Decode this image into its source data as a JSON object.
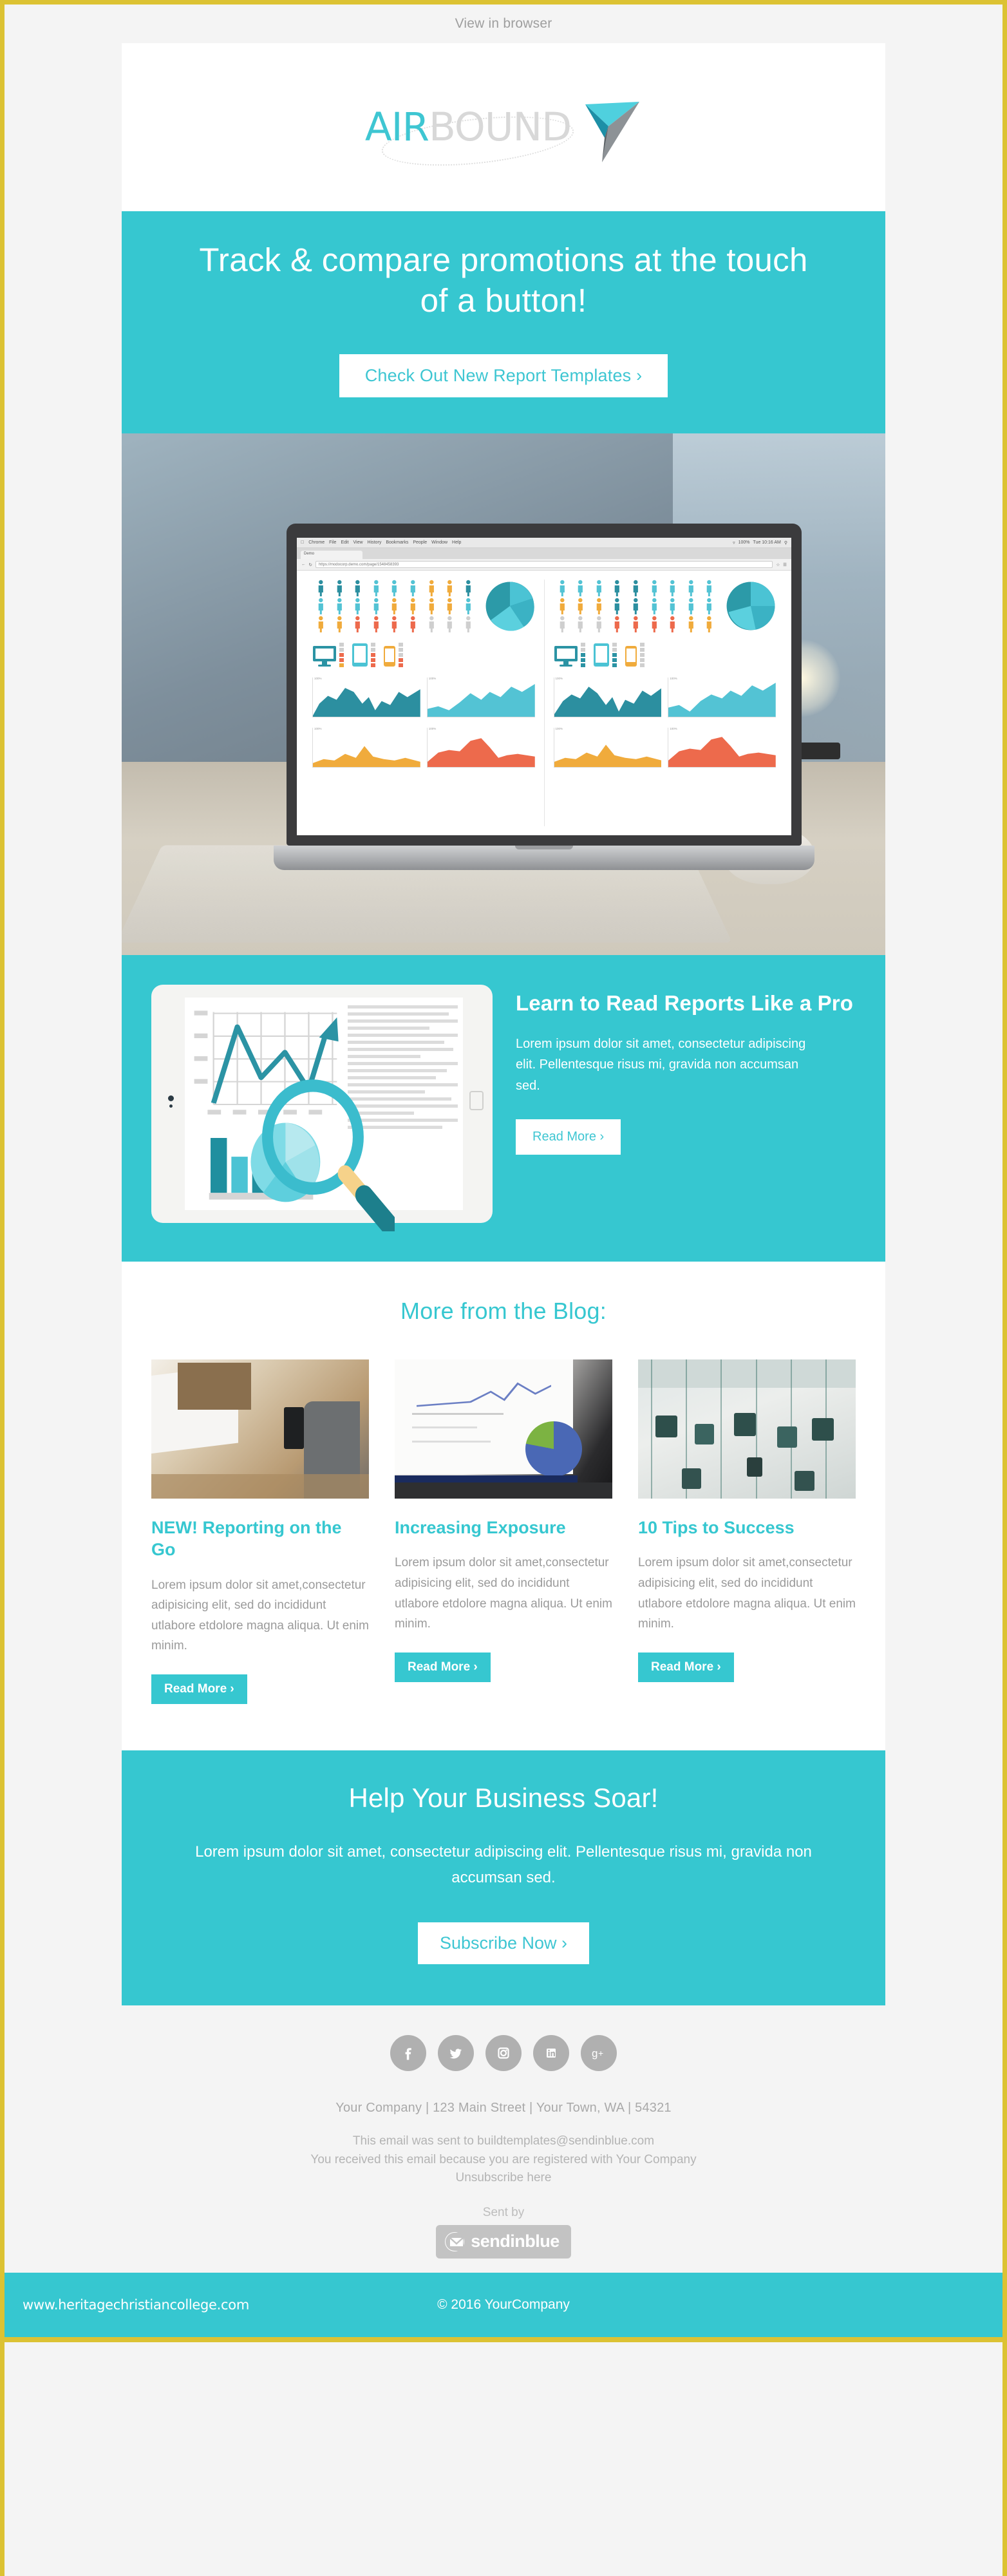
{
  "preheader": {
    "view_in_browser": "View in browser"
  },
  "brand": {
    "logo_air": "AIR",
    "logo_bound": "BOUND",
    "accent_color": "#36c7d0",
    "logo_teal": "#3ec6d2",
    "logo_gray": "#d8d8d8",
    "border_color": "#dcc233"
  },
  "hero": {
    "headline": "Track & compare promotions at the touch of a button!",
    "cta_label": "Check Out New Report Templates  ›"
  },
  "hero_image": {
    "browser": {
      "apple": "",
      "menus": [
        "Chrome",
        "File",
        "Edit",
        "View",
        "History",
        "Bookmarks",
        "People",
        "Window",
        "Help"
      ],
      "battery": "100%",
      "clock": "Tue 10:16 AM",
      "tab_title": "Demo",
      "url": "https://modocorp.demo.com/page/1548458393"
    }
  },
  "feature": {
    "heading": "Learn to Read Reports Like a Pro",
    "body": "Lorem ipsum dolor sit amet, consectetur adipiscing elit. Pellentesque risus mi, gravida non accumsan sed.",
    "cta_label": "Read More ›"
  },
  "blog": {
    "heading": "More from the Blog:",
    "posts": [
      {
        "title": "NEW! Reporting on the Go",
        "body": "Lorem ipsum dolor sit amet,consectetur adipisicing elit, sed do incididunt utlabore etdolore magna aliqua. Ut enim minim.",
        "cta_label": "Read More ›",
        "image_alt": "desk-with-laptop-and-phone"
      },
      {
        "title": "Increasing Exposure",
        "body": "Lorem ipsum dolor sit amet,consectetur adipisicing elit, sed do incididunt utlabore etdolore magna aliqua. Ut enim minim.",
        "cta_label": "Read More ›",
        "image_alt": "laptop-showing-analytics-chart"
      },
      {
        "title": "10 Tips to Success",
        "body": "Lorem ipsum dolor sit amet,consectetur adipisicing elit, sed do incididunt utlabore etdolore magna aliqua. Ut enim minim.",
        "cta_label": "Read More ›",
        "image_alt": "overhead-view-of-crowd-in-atrium"
      }
    ]
  },
  "cta": {
    "heading": "Help Your Business Soar!",
    "body": "Lorem ipsum dolor sit amet, consectetur adipiscing elit. Pellentesque risus mi, gravida non accumsan sed.",
    "button_label": "Subscribe Now ›"
  },
  "footer": {
    "socials": [
      {
        "name": "facebook",
        "glyph": "f"
      },
      {
        "name": "twitter",
        "glyph": "t"
      },
      {
        "name": "instagram",
        "glyph": "i"
      },
      {
        "name": "linkedin",
        "glyph": "in"
      },
      {
        "name": "googleplus",
        "glyph": "g+"
      }
    ],
    "address": "Your Company  |  123 Main Street  |  Your Town, WA  |  54321",
    "sent_to": "This email was sent to buildtemplates@sendinblue.com",
    "registered": "You received this email because you are registered with Your Company",
    "unsubscribe": "Unsubscribe here",
    "sent_by": "Sent by",
    "provider": "sendinblue",
    "copyright": "© 2016 YourCompany",
    "watermark": "www.heritagechristiancollege.com"
  }
}
